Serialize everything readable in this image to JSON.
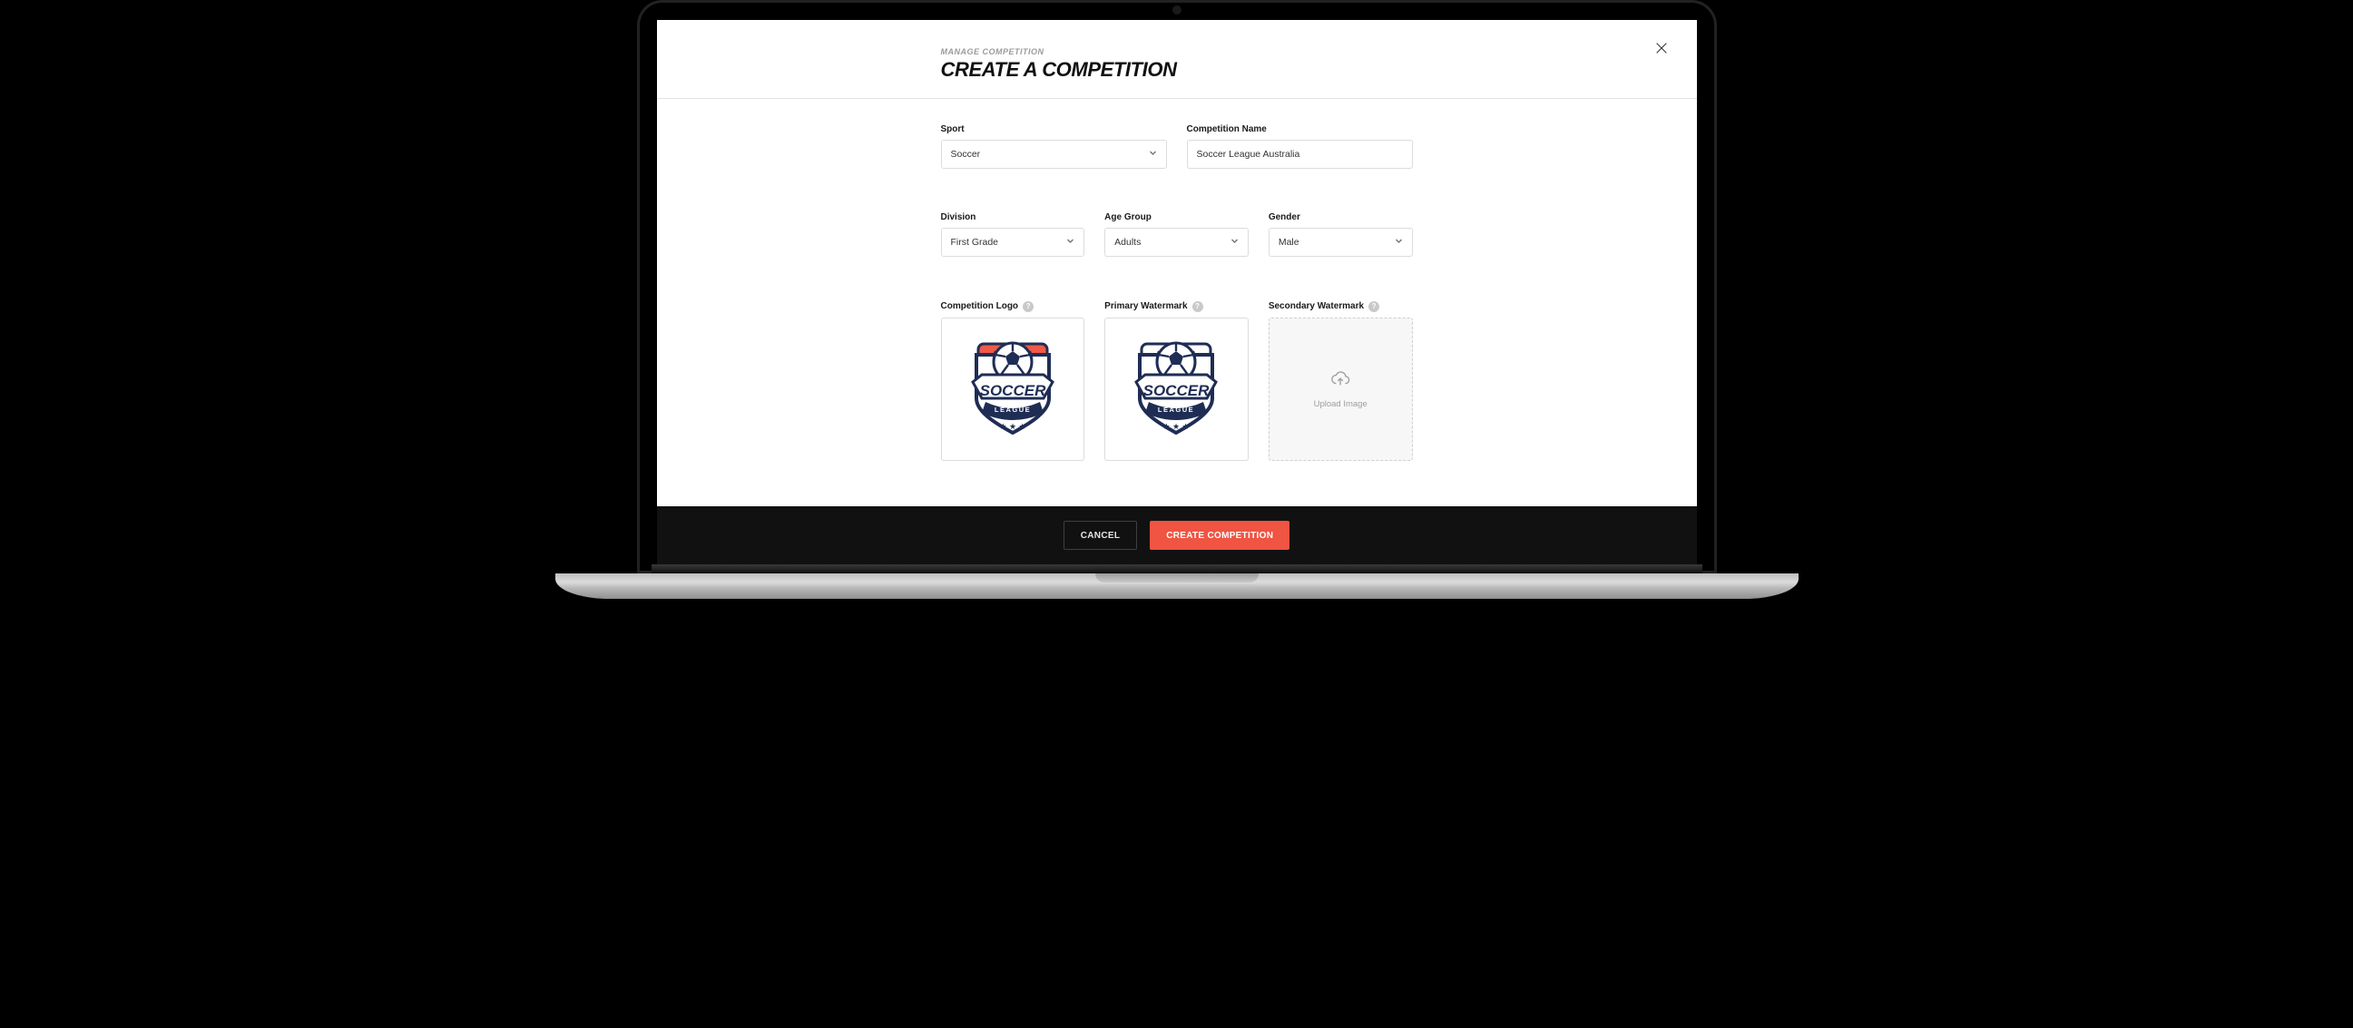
{
  "header": {
    "breadcrumb": "MANAGE COMPETITION",
    "title": "CREATE A COMPETITION"
  },
  "form": {
    "sport": {
      "label": "Sport",
      "value": "Soccer"
    },
    "competition_name": {
      "label": "Competition Name",
      "value": "Soccer League Australia"
    },
    "division": {
      "label": "Division",
      "value": "First Grade"
    },
    "age_group": {
      "label": "Age Group",
      "value": "Adults"
    },
    "gender": {
      "label": "Gender",
      "value": "Male"
    },
    "logo": {
      "label": "Competition Logo",
      "badge_text_main": "SOCCER",
      "badge_text_sub": "LEAGUE",
      "variant": "red"
    },
    "primary_watermark": {
      "label": "Primary Watermark",
      "badge_text_main": "SOCCER",
      "badge_text_sub": "LEAGUE",
      "variant": "navy"
    },
    "secondary_watermark": {
      "label": "Secondary Watermark",
      "placeholder_text": "Upload Image"
    }
  },
  "footer": {
    "cancel": "CANCEL",
    "submit": "CREATE COMPETITION"
  },
  "icons": {
    "close": "close-icon",
    "help": "?",
    "upload": "cloud-upload-icon"
  },
  "colors": {
    "accent": "#f05442",
    "navy": "#1f2d55"
  }
}
